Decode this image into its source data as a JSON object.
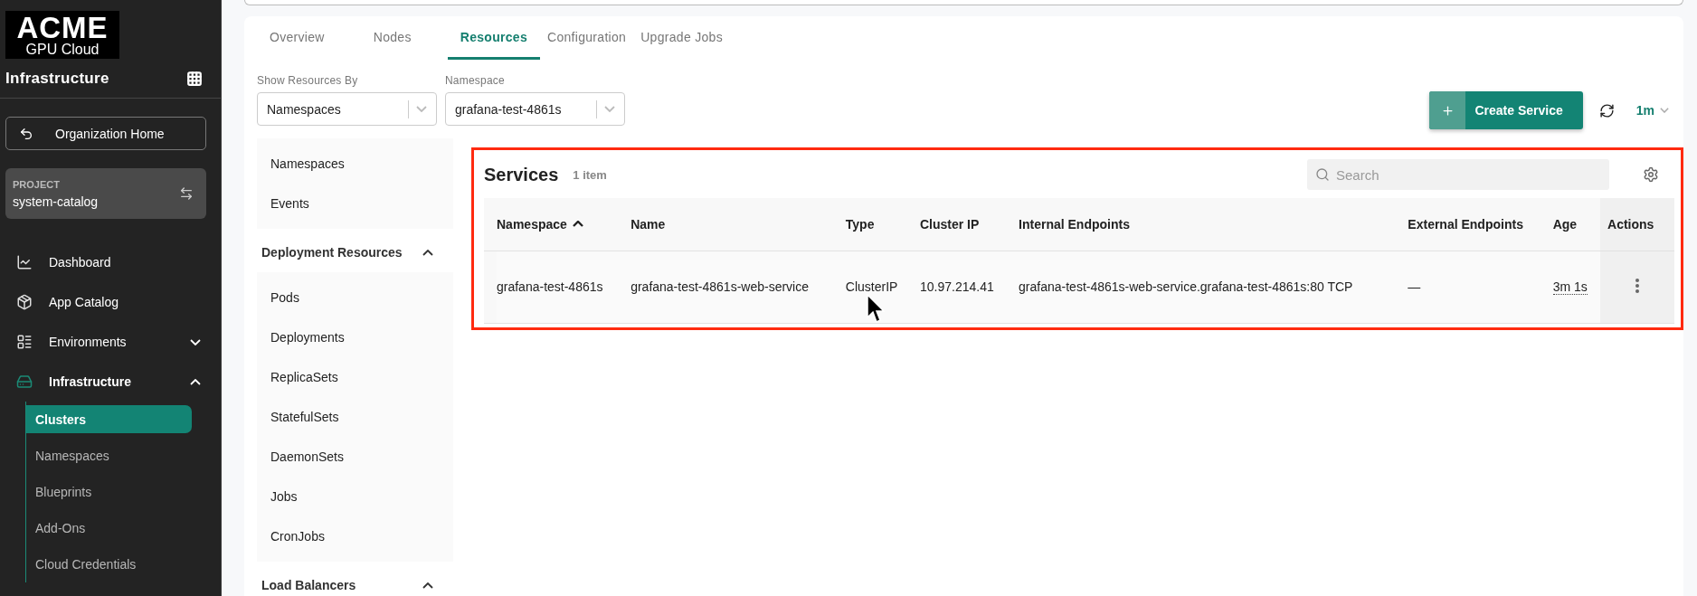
{
  "sidebar": {
    "logo": {
      "title": "ACME",
      "subtitle": "GPU Cloud"
    },
    "section_title": "Infrastructure",
    "back_button": "Organization Home",
    "project": {
      "label": "PROJECT",
      "name": "system-catalog"
    },
    "nav": [
      {
        "label": "Dashboard",
        "selected": false
      },
      {
        "label": "App Catalog",
        "selected": false
      },
      {
        "label": "Environments",
        "selected": false,
        "expanded": false
      },
      {
        "label": "Infrastructure",
        "selected": true,
        "expanded": true,
        "children": [
          {
            "label": "Clusters",
            "selected": true
          },
          {
            "label": "Namespaces",
            "selected": false
          },
          {
            "label": "Blueprints",
            "selected": false
          },
          {
            "label": "Add-Ons",
            "selected": false
          },
          {
            "label": "Cloud Credentials",
            "selected": false
          }
        ]
      }
    ]
  },
  "tabs": [
    {
      "label": "Overview",
      "selected": false
    },
    {
      "label": "Nodes",
      "selected": false
    },
    {
      "label": "Resources",
      "selected": true
    },
    {
      "label": "Configuration",
      "selected": false
    },
    {
      "label": "Upgrade Jobs",
      "selected": false
    }
  ],
  "filters": [
    {
      "label": "Show Resources By",
      "value": "Namespaces"
    },
    {
      "label": "Namespace",
      "value": "grafana-test-4861s"
    }
  ],
  "create_button": "Create Service",
  "refresh_interval": "1m",
  "resource_groups": [
    {
      "items": [
        "Namespaces",
        "Events"
      ]
    },
    {
      "title": "Deployment Resources",
      "expanded": true,
      "items": [
        "Pods",
        "Deployments",
        "ReplicaSets",
        "StatefulSets",
        "DaemonSets",
        "Jobs",
        "CronJobs"
      ]
    },
    {
      "title": "Load Balancers",
      "expanded": true
    }
  ],
  "services": {
    "title": "Services",
    "count": "1 item",
    "search": {
      "placeholder": "Search"
    },
    "columns": [
      {
        "label": "Namespace",
        "sort_ascending": true
      },
      {
        "label": "Name"
      },
      {
        "label": "Type"
      },
      {
        "label": "Cluster IP"
      },
      {
        "label": "Internal Endpoints"
      },
      {
        "label": "External Endpoints"
      },
      {
        "label": "Age"
      },
      {
        "label": "Actions"
      }
    ],
    "rows": [
      {
        "cells": [
          "grafana-test-4861s",
          "grafana-test-4861s-web-service",
          "ClusterIP",
          "10.97.214.41",
          "grafana-test-4861s-web-service.grafana-test-4861s:80 TCP",
          "—",
          "3m 1s"
        ]
      }
    ]
  }
}
